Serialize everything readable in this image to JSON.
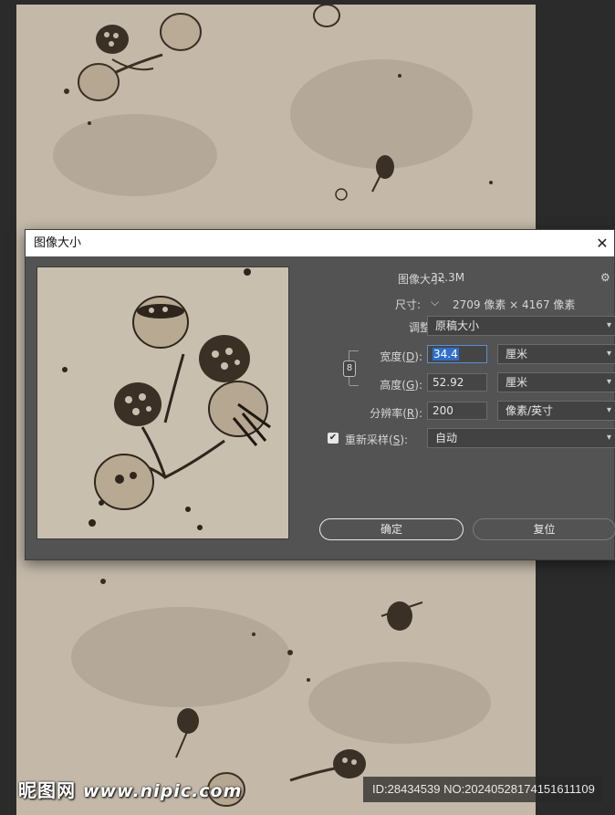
{
  "dialog": {
    "title": "图像大小",
    "image_size_label": "图像大小:",
    "image_size_value": "32.3M",
    "dimensions_label": "尺寸:",
    "dimensions_value": "2709 像素  ×  4167 像素",
    "fit_to_label": "调整为:",
    "fit_to_value": "原稿大小",
    "width_label": "宽度(",
    "width_key": "D",
    "width_value": "34.4",
    "width_unit": "厘米",
    "height_label": "高度(",
    "height_key": "G",
    "height_value": "52.92",
    "height_unit": "厘米",
    "resolution_label": "分辨率(",
    "resolution_key": "R",
    "resolution_value": "200",
    "resolution_unit": "像素/英寸",
    "resample_label": "重新采样(",
    "resample_key": "S",
    "resample_value": "自动",
    "label_close": "):",
    "ok_label": "确定",
    "reset_label": "复位"
  },
  "watermark": {
    "brand": "昵图网",
    "url": "www.nipic.com",
    "id_text": "ID:28434539 NO:20240528174151611109"
  },
  "icons": {
    "close": "close-icon",
    "gear": "gear-icon",
    "link": "chain-link-icon",
    "checkbox": "checkmark-icon",
    "chevron": "chevron-down-icon"
  },
  "colors": {
    "dialog_bg": "#535353",
    "paper": "#c4b9a9",
    "accent": "#2f6fc8"
  }
}
